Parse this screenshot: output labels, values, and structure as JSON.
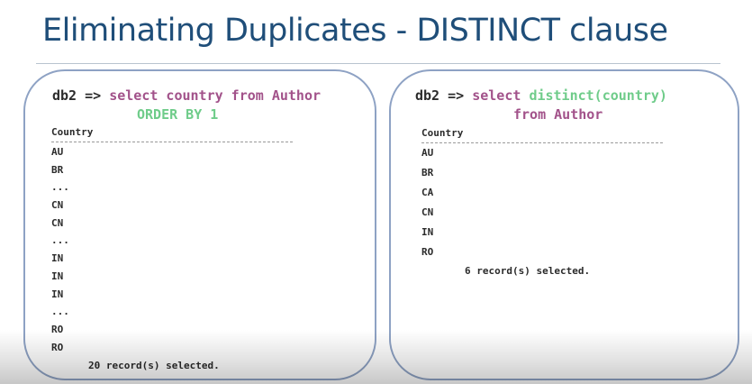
{
  "slide": {
    "title": "Eliminating Duplicates - DISTINCT clause"
  },
  "left": {
    "prompt": "db2 =>",
    "line1": "select country from Author",
    "line2": "ORDER BY 1",
    "column_header": "Country",
    "rows": [
      "AU",
      "BR",
      "...",
      "CN",
      "CN",
      "...",
      "IN",
      "IN",
      "IN",
      "...",
      "RO",
      "RO"
    ],
    "footer": "20 record(s) selected."
  },
  "right": {
    "prompt": "db2 =>",
    "select_kw": "select",
    "distinct_expr": "distinct(country)",
    "line2": "from Author",
    "column_header": "Country",
    "rows": [
      "AU",
      "BR",
      "CA",
      "CN",
      "IN",
      "RO"
    ],
    "footer": "6 record(s) selected."
  },
  "colors": {
    "title": "#1f4e79",
    "panel_border": "#8ea2c4",
    "keyword_purple": "#a2528a",
    "keyword_green": "#6fcc8a"
  }
}
